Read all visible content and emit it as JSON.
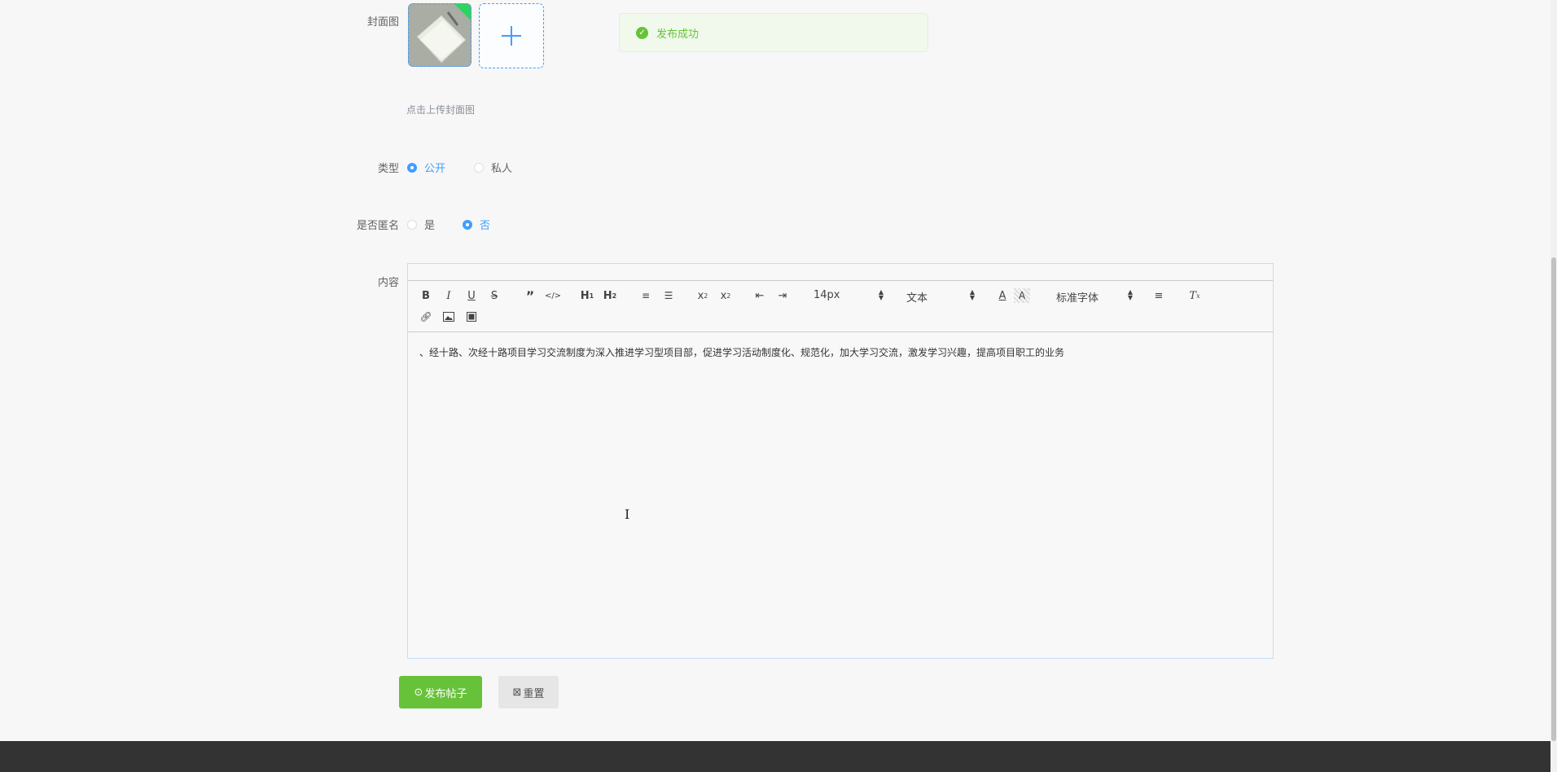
{
  "form": {
    "cover_label": "封面图",
    "cover_hint": "点击上传封面图",
    "type_label": "类型",
    "type_options": [
      "公开",
      "私人"
    ],
    "type_selected": "公开",
    "anonymous_label": "是否匿名",
    "anonymous_options": [
      "是",
      "否"
    ],
    "anonymous_selected": "否",
    "content_label": "内容"
  },
  "toast": {
    "message": "发布成功",
    "icon": "check-circle-icon",
    "color": "#67c23a"
  },
  "editor": {
    "toolbar": {
      "font_size": "14px",
      "header": "文本",
      "font_family": "标准字体",
      "buttons": [
        "bold-icon",
        "italic-icon",
        "underline-icon",
        "strike-icon",
        "blockquote-icon",
        "code-block-icon",
        "h1-icon",
        "h2-icon",
        "ordered-list-icon",
        "bullet-list-icon",
        "subscript-icon",
        "superscript-icon",
        "outdent-icon",
        "indent-icon",
        "font-color-icon",
        "background-color-icon",
        "align-icon",
        "clean-format-icon",
        "link-icon",
        "image-icon",
        "video-icon"
      ]
    },
    "content": "、经十路、次经十路项目学习交流制度为深入推进学习型项目部，促进学习活动制度化、规范化，加大学习交流，激发学习兴趣，提高项目职工的业务"
  },
  "actions": {
    "publish_label": "发布帖子",
    "reset_label": "重置"
  },
  "colors": {
    "primary": "#409eff",
    "success": "#67c23a",
    "footer": "#333333"
  }
}
